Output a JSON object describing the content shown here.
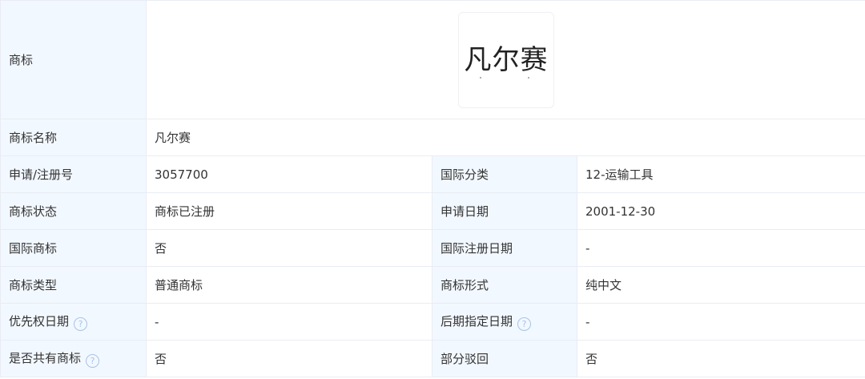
{
  "logo": {
    "label": "商标",
    "image_text": "凡尔赛"
  },
  "rows": [
    {
      "label": "商标名称",
      "value": "凡尔赛"
    },
    {
      "label": "申请/注册号",
      "value": "3057700",
      "label2": "国际分类",
      "value2": "12-运输工具"
    },
    {
      "label": "商标状态",
      "value": "商标已注册",
      "label2": "申请日期",
      "value2": "2001-12-30"
    },
    {
      "label": "国际商标",
      "value": "否",
      "label2": "国际注册日期",
      "value2": "-"
    },
    {
      "label": "商标类型",
      "value": "普通商标",
      "label2": "商标形式",
      "value2": "纯中文"
    },
    {
      "label": "优先权日期",
      "value": "-",
      "label2": "后期指定日期",
      "value2": "-"
    },
    {
      "label": "是否共有商标",
      "value": "否",
      "label2": "部分驳回",
      "value2": "否"
    }
  ],
  "help_glyph": "?"
}
